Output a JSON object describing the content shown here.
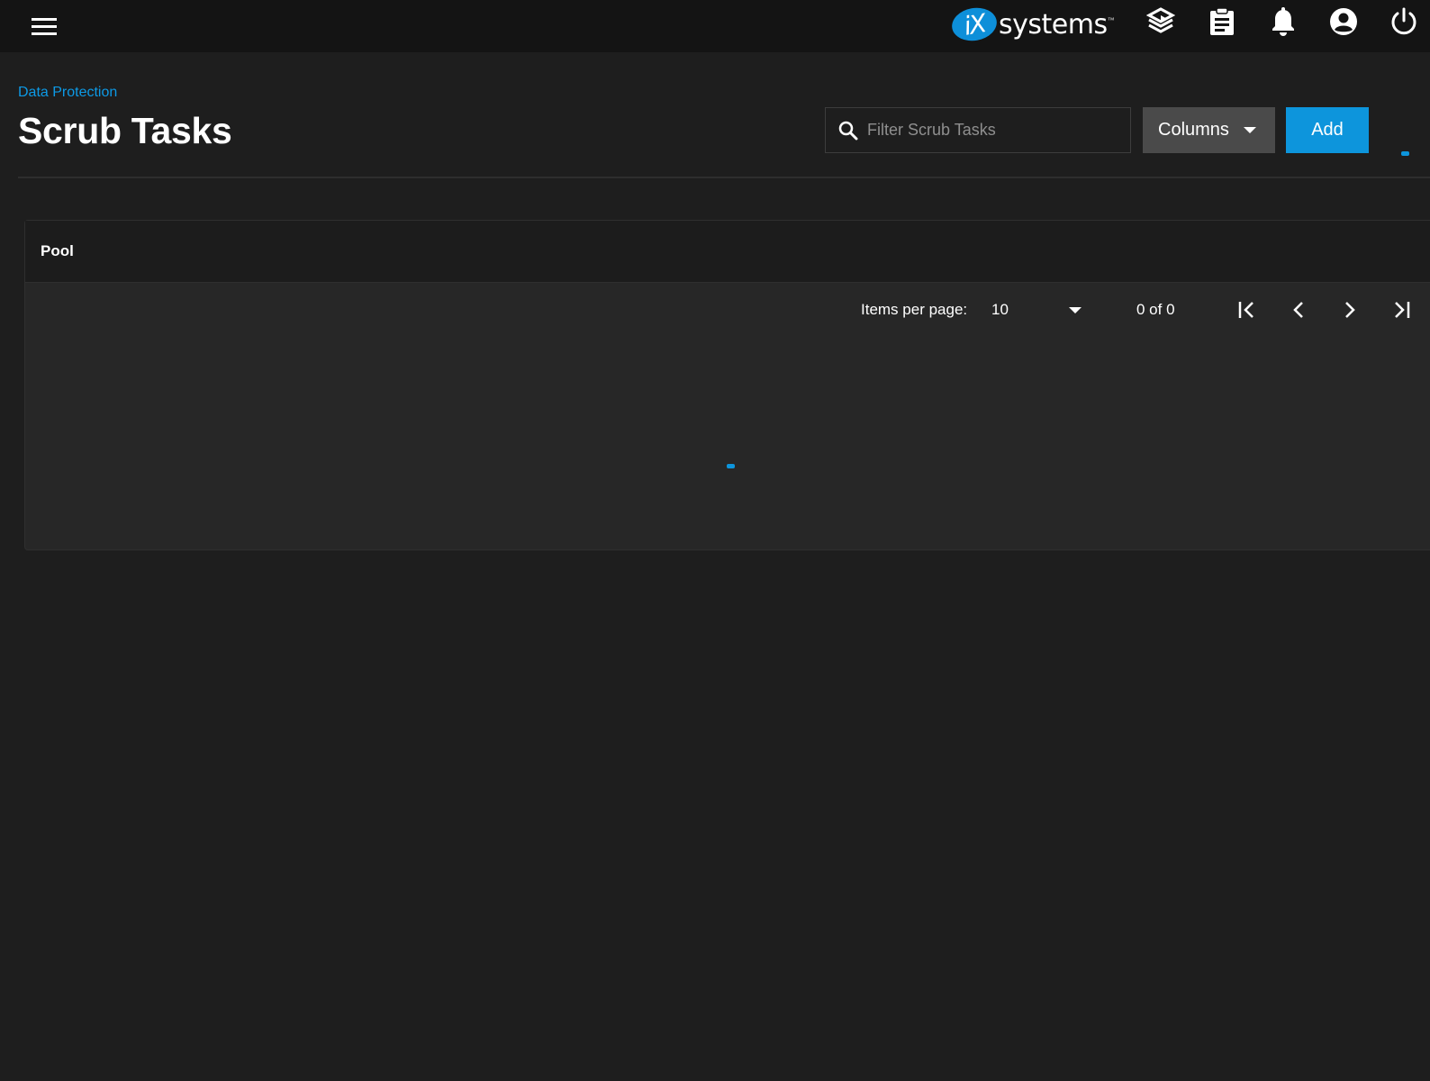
{
  "topbar": {
    "brand_mark": "iX",
    "brand_word": "systems",
    "brand_tm": "™",
    "icons": [
      "menu-icon",
      "truecommand-icon",
      "clipboard-icon",
      "bell-icon",
      "account-circle-icon",
      "power-icon"
    ]
  },
  "breadcrumb": "Data Protection",
  "page_title": "Scrub Tasks",
  "toolbar": {
    "search_placeholder": "Filter Scrub Tasks",
    "search_value": "",
    "columns_label": "Columns",
    "add_label": "Add"
  },
  "table": {
    "columns": [
      "Pool"
    ],
    "rows": []
  },
  "paginator": {
    "items_per_page_label": "Items per page:",
    "items_per_page_value": "10",
    "range_label": "0 of 0"
  },
  "colors": {
    "accent": "#0d95dc",
    "background": "#1e1e1e",
    "topbar": "#141414"
  }
}
